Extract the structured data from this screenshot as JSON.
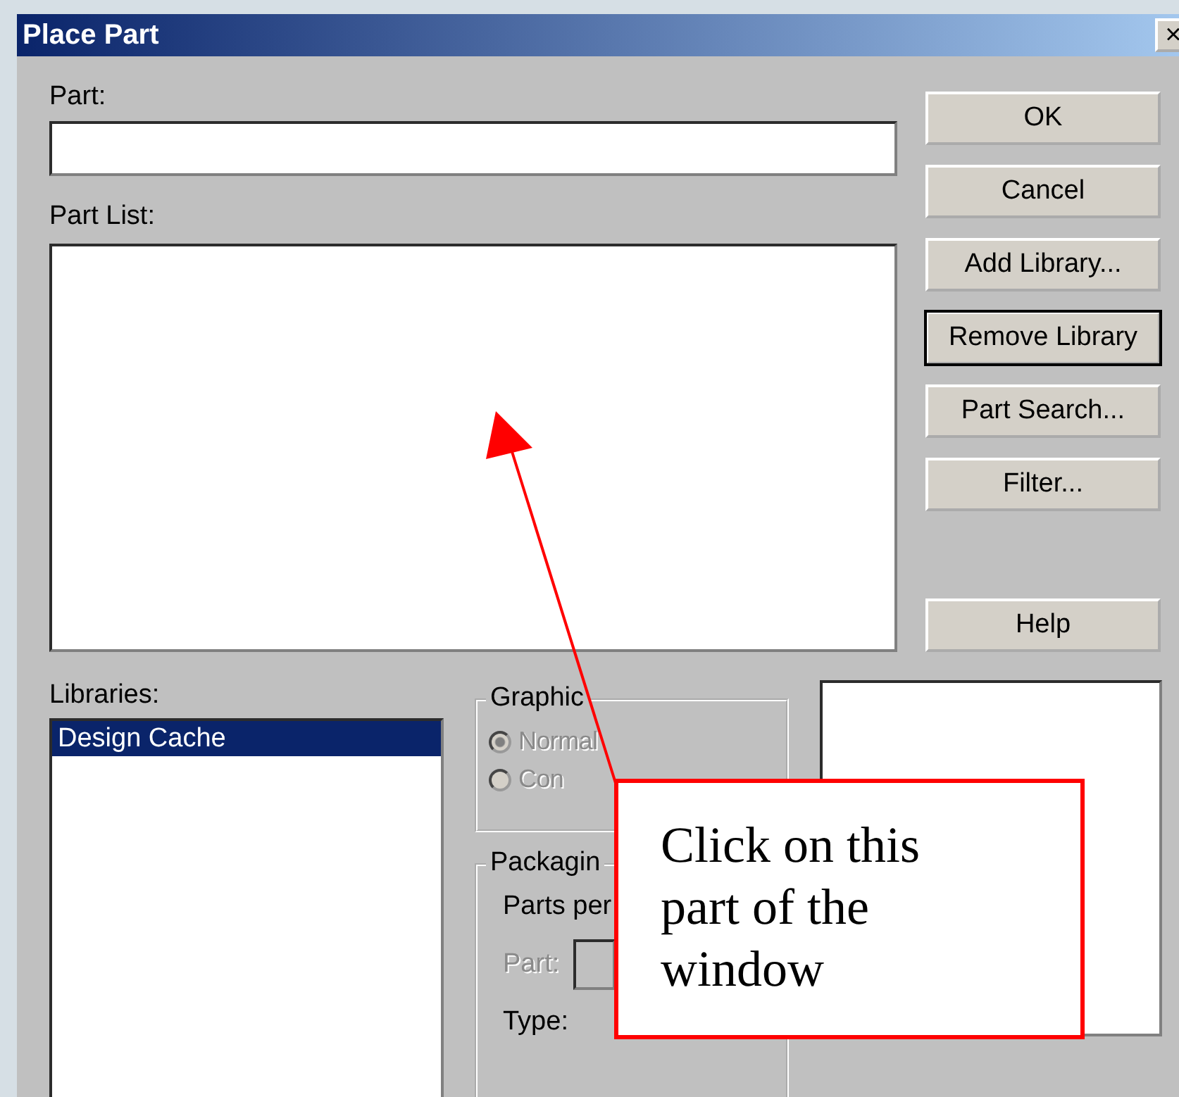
{
  "window": {
    "title": "Place Part",
    "close": "×"
  },
  "part": {
    "label": "Part:"
  },
  "part_list": {
    "label": "Part List:"
  },
  "buttons": [
    {
      "label": "OK",
      "focused": false
    },
    {
      "label": "Cancel",
      "focused": false
    },
    {
      "label": "Add Library...",
      "focused": false
    },
    {
      "label": "Remove Library",
      "focused": true
    },
    {
      "label": "Part Search...",
      "focused": false
    },
    {
      "label": "Filter...",
      "focused": false
    },
    {
      "label": "Help",
      "focused": false
    }
  ],
  "libraries": {
    "label": "Libraries:",
    "items": [
      {
        "label": "Design Cache",
        "selected": true
      }
    ]
  },
  "graphic": {
    "title": "Graphic",
    "options": [
      {
        "label": "Normal",
        "selected": true,
        "disabled": true
      },
      {
        "label": "Con",
        "selected": false,
        "disabled": true
      }
    ]
  },
  "packaging": {
    "title": "Packagin",
    "parts_per": "Parts per",
    "part": {
      "label": "Part:",
      "disabled": true
    },
    "type": "Type:"
  },
  "callout": {
    "text": "Click on this part of the window"
  }
}
